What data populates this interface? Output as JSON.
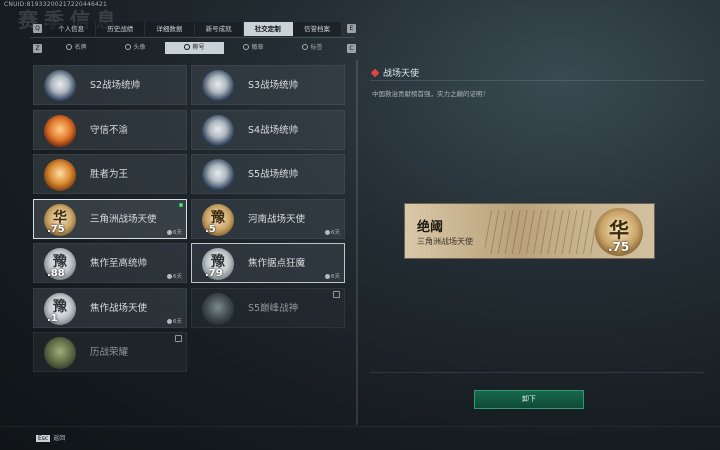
{
  "header": {
    "uid": "CNUID:81933200217220446421",
    "bg_title": "赛季信息"
  },
  "tabs": [
    {
      "label": "个人信息",
      "active": false
    },
    {
      "label": "历史战绩",
      "active": false
    },
    {
      "label": "详细数据",
      "active": false
    },
    {
      "label": "新号成就",
      "active": false
    },
    {
      "label": "社交定制",
      "active": true
    },
    {
      "label": "信誉档案",
      "active": false
    }
  ],
  "keys": {
    "left": "Q",
    "right": "E",
    "sub_left": "Z",
    "sub_right": "C"
  },
  "subtabs": [
    {
      "label": "名牌",
      "active": false
    },
    {
      "label": "头像",
      "active": false
    },
    {
      "label": "称号",
      "active": true
    },
    {
      "label": "徽章",
      "active": false
    },
    {
      "label": "标签",
      "active": false
    }
  ],
  "titles": [
    {
      "name": "S2战场统帅",
      "badge": "b-ship",
      "num": "",
      "timer": "",
      "locked": false,
      "selected": false,
      "new": false
    },
    {
      "name": "S3战场统帅",
      "badge": "b-ship",
      "num": "",
      "timer": "",
      "locked": false,
      "selected": false,
      "new": false
    },
    {
      "name": "守信不渝",
      "badge": "b-scales",
      "num": "",
      "timer": "",
      "locked": false,
      "selected": false,
      "new": false
    },
    {
      "name": "S4战场统帅",
      "badge": "b-ship",
      "num": "",
      "timer": "",
      "locked": false,
      "selected": false,
      "new": false
    },
    {
      "name": "胜者为王",
      "badge": "b-medal",
      "num": "",
      "timer": "",
      "locked": false,
      "selected": false,
      "new": false
    },
    {
      "name": "S5战场统帅",
      "badge": "b-ship",
      "num": "",
      "timer": "",
      "locked": false,
      "selected": false,
      "new": false
    },
    {
      "name": "三角洲战场天使",
      "badge": "b-gold",
      "glyph": "华",
      "num": ".75",
      "timer": "6天",
      "locked": false,
      "selected": true,
      "new": true
    },
    {
      "name": "河南战场天使",
      "badge": "b-gold",
      "glyph": "豫",
      "num": ".5",
      "timer": "6天",
      "locked": false,
      "selected": false,
      "new": false
    },
    {
      "name": "焦作至高统帅",
      "badge": "b-silver",
      "glyph": "豫",
      "num": ".88",
      "timer": "6天",
      "locked": false,
      "selected": false,
      "new": false
    },
    {
      "name": "焦作据点狂魔",
      "badge": "b-silver",
      "glyph": "豫",
      "num": ".79",
      "timer": "6天",
      "locked": false,
      "selected": false,
      "new": false,
      "highlight": true
    },
    {
      "name": "焦作战场天使",
      "badge": "b-silver",
      "glyph": "豫",
      "num": ".1",
      "timer": "6天",
      "locked": false,
      "selected": false,
      "new": false
    },
    {
      "name": "S5巅峰战神",
      "badge": "b-dark",
      "num": "",
      "timer": "",
      "locked": true,
      "selected": false,
      "new": false
    },
    {
      "name": "历战荣耀",
      "badge": "b-green",
      "num": "",
      "timer": "",
      "locked": true,
      "selected": false,
      "new": false
    }
  ],
  "detail": {
    "title": "战场天使",
    "description": "中国救治贡献榜首强，实力之巅的证明！",
    "plate_main": "绝阈",
    "plate_sub": "三角洲战场天使",
    "plate_glyph": "华",
    "plate_num": ".75"
  },
  "actions": {
    "unequip": "卸下",
    "esc_key": "Esc",
    "esc_label": "返回"
  },
  "colors": {
    "accent_red": "#e2463c",
    "button_green": "#18684c",
    "new_dot": "#3ddc64"
  }
}
